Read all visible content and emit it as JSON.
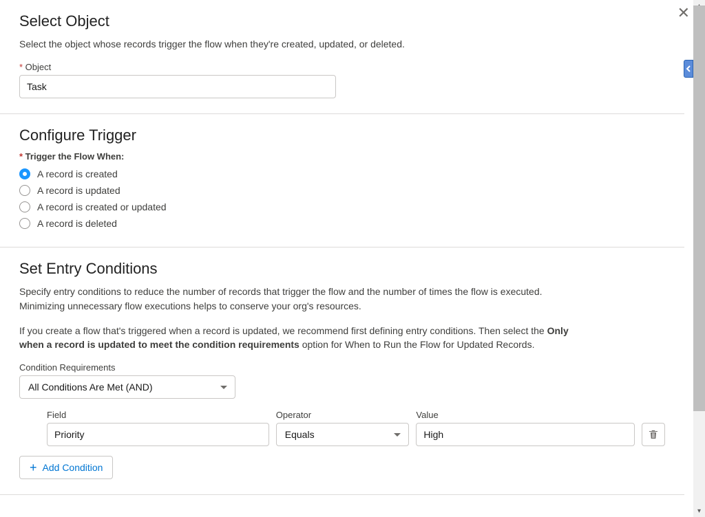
{
  "selectObject": {
    "heading": "Select Object",
    "helper": "Select the object whose records trigger the flow when they're created, updated, or deleted.",
    "objectLabel": "Object",
    "objectValue": "Task"
  },
  "configureTrigger": {
    "heading": "Configure Trigger",
    "whenLabel": "Trigger the Flow When:",
    "options": [
      "A record is created",
      "A record is updated",
      "A record is created or updated",
      "A record is deleted"
    ],
    "selectedIndex": 0
  },
  "entryConditions": {
    "heading": "Set Entry Conditions",
    "helper1": "Specify entry conditions to reduce the number of records that trigger the flow and the number of times the flow is executed. Minimizing unnecessary flow executions helps to conserve your org's resources.",
    "helper2a": "If you create a flow that's triggered when a record is updated, we recommend first defining entry conditions. Then select the ",
    "helper2bold": "Only when a record is updated to meet the condition requirements",
    "helper2b": " option for When to Run the Flow for Updated Records.",
    "conditionReqLabel": "Condition Requirements",
    "conditionReqValue": "All Conditions Are Met (AND)",
    "row": {
      "fieldLabel": "Field",
      "fieldValue": "Priority",
      "operatorLabel": "Operator",
      "operatorValue": "Equals",
      "valueLabel": "Value",
      "valueValue": "High"
    },
    "addConditionLabel": "Add Condition"
  }
}
